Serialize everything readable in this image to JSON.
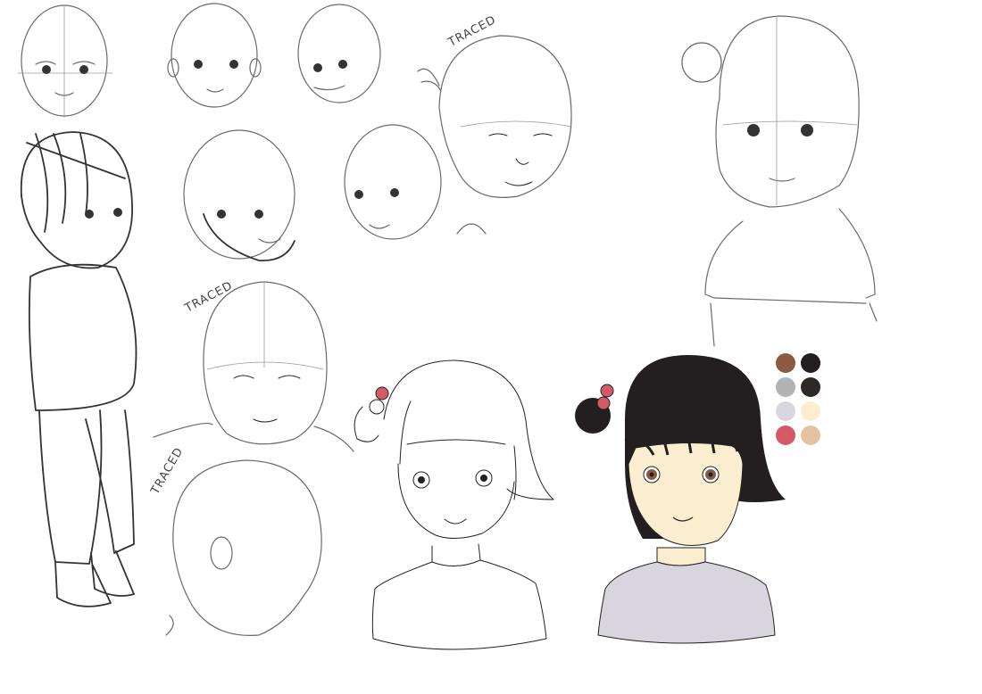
{
  "labels": {
    "traced_1": "TRACED",
    "traced_2": "TRACED",
    "traced_3": "TRACED"
  },
  "palette": {
    "swatches": [
      {
        "name": "brown",
        "color": "#8b5a43"
      },
      {
        "name": "near-black",
        "color": "#231e1f"
      },
      {
        "name": "gray",
        "color": "#b1b3b5"
      },
      {
        "name": "dark-brown",
        "color": "#2e2826"
      },
      {
        "name": "lavender-gray",
        "color": "#d9d5de"
      },
      {
        "name": "cream",
        "color": "#fbedcf"
      },
      {
        "name": "rose-red",
        "color": "#d35a66"
      },
      {
        "name": "tan",
        "color": "#e3c3a0"
      }
    ]
  },
  "colors": {
    "hair": "#231e1f",
    "skin": "#fbedcf",
    "shirt": "#d9d5de",
    "bow": "#d35a66",
    "iris": "#8b5a43"
  }
}
